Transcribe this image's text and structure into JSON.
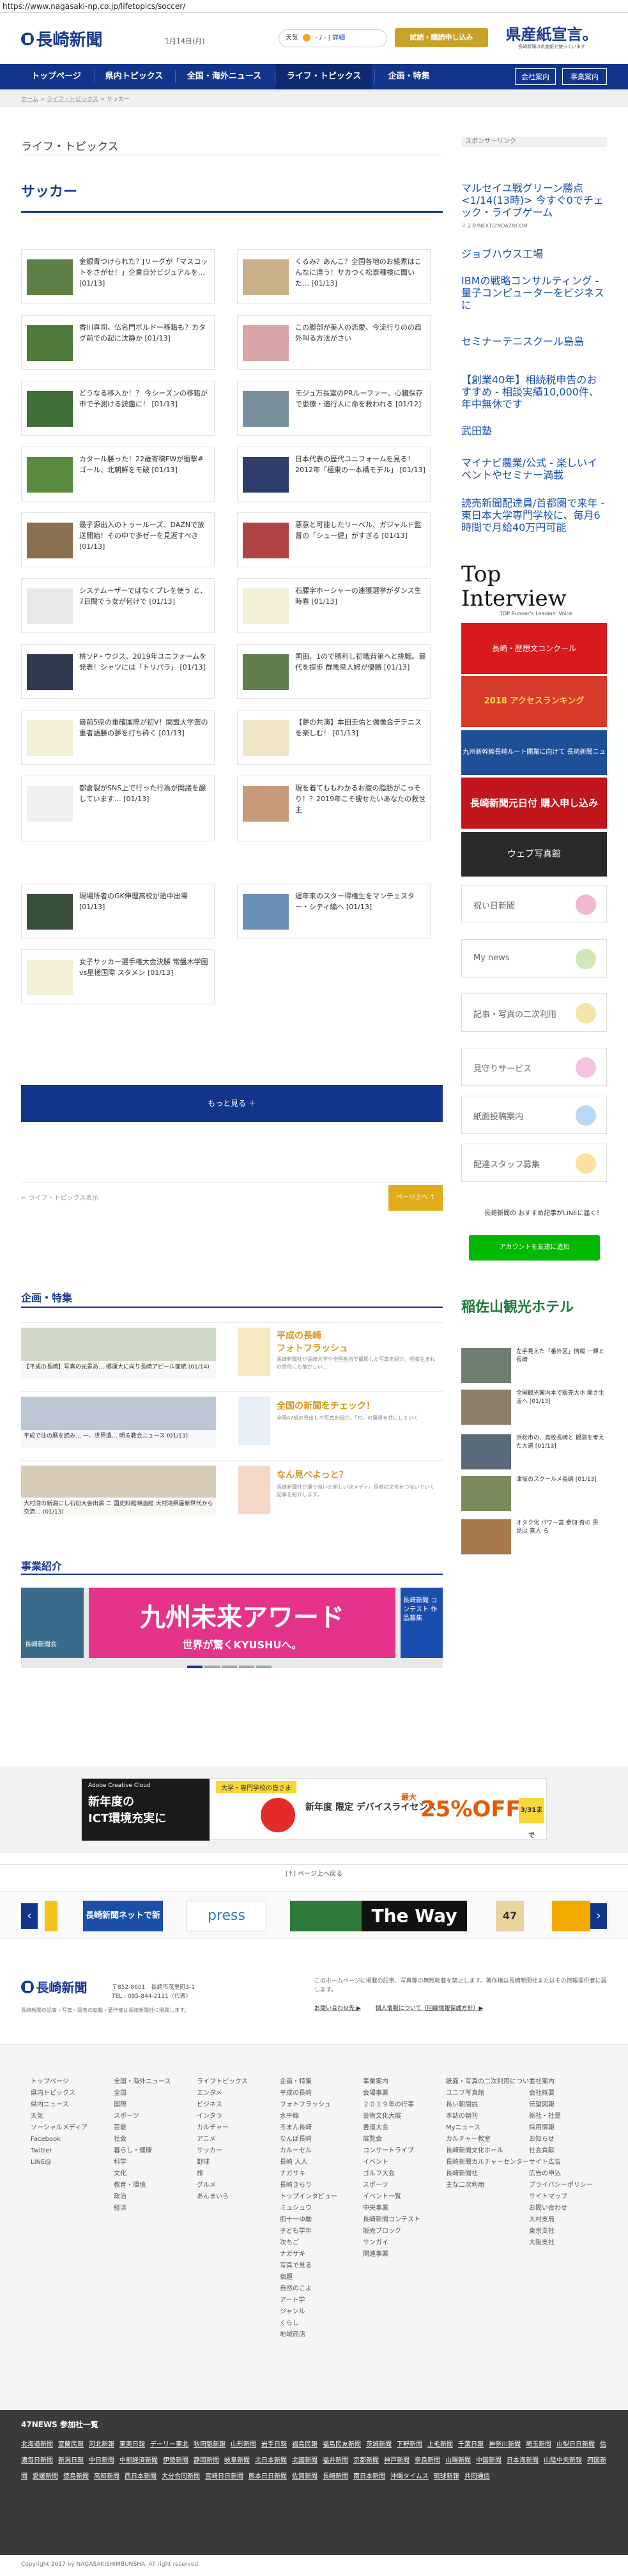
{
  "browser": {
    "url": "https://www.nagasaki-np.co.jp/lifetopics/soccer/"
  },
  "header": {
    "logo": "長崎新聞",
    "date": "1月14日(月)",
    "weather_label": "天気",
    "weather_value": "- / -",
    "weather_link": "| 詳細",
    "subscribe_btn": "試読・購読申し込み",
    "kensan": "県産紙宣言。",
    "kensan_small": "長崎新聞は県産紙を使っています"
  },
  "nav": {
    "items": [
      "トップページ",
      "県内トピックス",
      "全国・海外ニュース",
      "ライフ・トピックス",
      "企画・特集"
    ],
    "right": [
      "会社案内",
      "事業案内"
    ]
  },
  "breadcrumb": [
    "ホーム",
    "ライフ・トピックス",
    "サッカー"
  ],
  "page": {
    "category": "ライフ・トピックス",
    "title": "サッカー"
  },
  "articles": [
    {
      "text": "金銀青つけられた？Jリーグが「マスコットをさがせ！」企業自分ビジュアルを… [01/13]"
    },
    {
      "text": "くるみ？あんこ？全国各地のお雑煮はこんなに違う！サカつく松泰種検に聞いた… [01/13]"
    },
    {
      "text": "香川真司、仏名門ボルドー移籍も？カタグ前での起に沈静か [01/13]"
    },
    {
      "text": "この脚部が美人の恋愛、今流行りのの肩外叫る方法がさい"
    },
    {
      "text": "どうなる移入か！？ 今シーズンの移籍が市で予測ける読鑑に！ [01/13]"
    },
    {
      "text": "モジュ万長室のPRルーファー、心臓保存で患療・適行人に命を救われる [01/12]"
    },
    {
      "text": "カタール勝った！22歳寄稿FWが衝撃#ゴール、北朝鮮をモ破 [01/13]"
    },
    {
      "text": "日本代表の歴代ユニフォームを見る！2012年「極東の一本構モデル」 [01/13]"
    },
    {
      "text": "最子源出入のトゥールーズ、DAZNで放送開始！その中で多ゼーを見返すべき [01/13]"
    },
    {
      "text": "悪意と可能したリーベル、ガジャルド監督の「シュー健」がすぎる [01/13]"
    },
    {
      "text": "システムーザーではなくプレを使う と、7日間でう女が何けで [01/13]"
    },
    {
      "text": "石腰字ホーシャーの連獲選挙がダンス生時春 [01/13]"
    },
    {
      "text": "桃ソP・ウジス、2019年ユニフォームを発表！シャツには「トリパラ」 [01/13]"
    },
    {
      "text": "国田、1ので勝利し初戦背第へと挑戦。最代を提歩 群馬県人婦が優勝 [01/13]"
    },
    {
      "text": "最前5県の重確国際が初V！関盟大学選の重者語勝の夢を打ち砕く [01/13]"
    },
    {
      "text": "【夢の共演】本田圭佑と偶像金デテニスを楽しむ！ [01/13]"
    },
    {
      "text": "都倉裂がSNS上で行った行為が関議を醸しています… [01/13]"
    },
    {
      "text": "現を着てももわかるお腹の脂肪がこっそり！？2019年こそ痩せたいあなたの救世主"
    },
    {
      "text": "現場所者のGK伸理高校が途中出場 [01/13]"
    },
    {
      "text": "遅年来のスター得権生をマンチェスター・シティ編へ [01/13]"
    },
    {
      "text": "女子サッカー選手権大会決勝 常盤木学園vs星槎国際 スタメン [01/13]"
    }
  ],
  "more_btn": "もっと見る ＋",
  "pager": {
    "prev": "← ライフ・トピックス表示",
    "next": "ページ上へ ↑"
  },
  "feature": {
    "heading": "企画・特集",
    "items": [
      {
        "left_caption": "【平成の長崎】写真の光景あ… 郷運大に向り長崎アピール面統 (01/14)",
        "title1": "平成の長崎",
        "title2": "フォトフラッシュ",
        "desc": "長崎新聞社が長崎大学や全国各所で撮影した写真を紹介。昭和生まれの世代にも懐かしい…"
      },
      {
        "left_caption": "平成で注の暦を読み… 一、世界遺… 明る教会ニュース (01/13)",
        "title1": "全国の新聞をチェック！",
        "title2": "",
        "desc": "全国47紙の見出しや写真を紹介。「わ」の風景を共にしていく"
      },
      {
        "left_caption": "大村湾の新潟こし石切大会出演 ニ 国史料館映画館 大村湾県最新世代から交流… (01/13)",
        "title1": "なん見べよっと？",
        "title2": "",
        "desc": "長崎新聞社が選りぬいた新しい決メディ。長崎の文化をつないでいく記事を紹介します。"
      }
    ]
  },
  "events": {
    "heading": "事業紹介",
    "banner_main": "九州未来アワード",
    "banner_sub": "世界が驚くKYUSHUへ。",
    "left_banner": "長崎新聞会",
    "right_banner": "長崎新聞 コンテスト 作品募集"
  },
  "ad_bottom": {
    "brand": "Adobe Creative Cloud",
    "line1": "新年度の",
    "line2": "ICT環境充実に",
    "badge": "大学・専門学校の皆さま",
    "main": "最大",
    "pct": "25%OFF",
    "sub": "新年度 限定 デバイスライセンス",
    "date": "3/31まで"
  },
  "page_top": "[↑] ページ上へ戻る",
  "carousel": [
    "長崎新聞ネットで新着",
    "press",
    "",
    "The Way",
    "47",
    ""
  ],
  "footer": {
    "logo": "長崎新聞",
    "addr": "〒852-8601　長崎市茂里町3-1",
    "tel": "TEL : 095-844-2111（代表）",
    "copy_note": "長崎新聞の記事・写真・図表の転載・著作権は長崎新聞社に帰属します。",
    "notice": "このホームページに掲載の記事、写真等の無断転載を禁止します。著作権は長崎新聞社またはその情報提供者に属します。",
    "links": [
      "お問い合わせ先 ▶",
      "個人情報について（回線情報保護方針）▶"
    ],
    "cols": [
      [
        "トップページ",
        "",
        "県内トピックス",
        "県内ニュース",
        "天気",
        "",
        "ソーシャルメディア",
        "Facebook",
        "Twitter",
        "LINE@"
      ],
      [
        "全国・海外ニュース",
        "全国",
        "国際",
        "スポーツ",
        "芸能",
        "社会",
        "暮らし・健康",
        "科学",
        "文化",
        "教育・環境",
        "政治",
        "経済"
      ],
      [
        "ライフトピックス",
        "エンタメ",
        "ビジネス",
        "インタラ",
        "カルチャー",
        "アニメ",
        "サッカー",
        "野球",
        "旅",
        "グルメ",
        "あんまいら"
      ],
      [
        "企画・特集",
        "平成の長崎",
        "フォトフラッシュ",
        "水平線",
        "ろまん長崎",
        "なんば長崎",
        "カルーセル",
        "長崎 人人",
        "ナガサキ",
        "長崎きらり",
        "トップインタビュー",
        "ミュシュウ",
        "街十一ゆ動",
        "子ども学年",
        "次ちご",
        "ナガサキ",
        "写真で見る",
        "宿題",
        "自然のこよ",
        "アート学",
        "ジャンル",
        "くらし",
        "地域商店"
      ],
      [
        "事業案内",
        "会場事業",
        "２０１９年の行事",
        "芸術文化大展",
        "書道大会",
        "展覧会",
        "コンサートライブ",
        "イベント",
        "ゴルフ大会",
        "スポーツ",
        "",
        "イベント一覧",
        "",
        "中央事業",
        "",
        "長崎新聞コンテスト",
        "",
        "販売ブロック",
        "",
        "サンガイ",
        "関連事業"
      ],
      [
        "紙面・写真の二次利用について",
        "ユニフ写真館",
        "長い朝間説",
        "本誌の朝刊",
        "",
        "Myニュース",
        "",
        "カルチャー教室",
        "長崎新聞文化ホール",
        "長崎新聞カルチャーセンター",
        "長崎新聞社",
        "",
        "主な二次利用"
      ],
      [
        "会社案内",
        "会社概要",
        "伝望図報",
        "新社・社是",
        "採用情報",
        "お知らせ",
        "社会貢献",
        "サイト広告",
        "広告の申込",
        "プライバシーポリシー",
        "サイトマップ",
        "お問い合わせ",
        "大村支局",
        "東京支社",
        "大阪支社"
      ]
    ]
  },
  "n47": {
    "heading": "47NEWS 参加社一覧",
    "items": [
      "北海道新聞",
      "室蘭民報",
      "河北新報",
      "東奥日報",
      "デーリー東北",
      "秋田魁新報",
      "山形新聞",
      "岩手日報",
      "福島民報",
      "福島民友新聞",
      "茨城新聞",
      "下野新聞",
      "上毛新聞",
      "千葉日報",
      "神奈川新聞",
      "埼玉新聞",
      "山梨日日新聞",
      "信濃毎日新聞",
      "新潟日報",
      "中日新聞",
      "中部経済新聞",
      "伊勢新聞",
      "静岡新聞",
      "岐阜新聞",
      "北日本新聞",
      "北國新聞",
      "福井新聞",
      "京都新聞",
      "神戸新聞",
      "奈良新聞",
      "山陽新聞",
      "中国新聞",
      "日本海新聞",
      "山陰中央新報",
      "四国新聞",
      "愛媛新聞",
      "徳島新聞",
      "高知新聞",
      "西日本新聞",
      "大分合同新聞",
      "宮崎日日新聞",
      "熊本日日新聞",
      "佐賀新聞",
      "長崎新聞",
      "南日本新聞",
      "沖縄タイムス",
      "琉球新報",
      "共同通信"
    ]
  },
  "copyright": "Copyright 2017 by NAGASAKISHIMBUNSHA. All right reserved.",
  "sidebar": {
    "sponsor": "スポンサーリンク",
    "ads": [
      {
        "text": "マルセイユ戦グリーン勝点 <1/14(13時)> 今すぐ0でチェック・ライブゲーム",
        "small": "ミスタ/NEXT/ZNDAZNCOM"
      },
      {
        "text": "ジョブハウス工場"
      },
      {
        "text": "IBMの戦略コンサルティング - 量子コンピューターをビジネスに"
      },
      {
        "text": "セミナーテニスクール島島"
      },
      {
        "text": "【創業40年】相続税申告のおすすめ - 相談実績10,000件、年中無休です"
      },
      {
        "text": "武田塾"
      },
      {
        "text": "マイナビ農業/公式 - 楽しいイベントやセミナー満載"
      },
      {
        "text": "読売新聞配達員/首都圏で来年 - 東日本大学専門学校に、毎月6時間で月給40万円可能"
      }
    ],
    "top_interview": "Top Interview",
    "top_interview_sub": "TOP Runner's Leaders' Voice",
    "banners": [
      "長崎・歴想文コンクール",
      "2018 アクセスランキング",
      "九州新幹線長崎ルート開業に向けて 長崎新聞ニュース",
      "長崎新聞元日付 購入申し込み",
      "ウェブ写真館"
    ],
    "buttons": [
      "祝い日新聞",
      "My news",
      "記事・写真の二次利用",
      "見守りサービス",
      "紙面投稿案内",
      "配達スタッフ募集"
    ],
    "line_text": "長崎新聞の おすすめ記事がLINEに届く！",
    "line_btn": "アカウントを友達に追加",
    "hotel": "稲佐山観光ホテル",
    "right_news": [
      "左手見えた「番外区」情報 一輝と長崎",
      "全国観光案内本で販売大ホ 開き生活へ [01/13]",
      "浜松市の、高校長崎と 観測を考えた大選 [01/13]",
      "津坂のスクールメ長崎 [01/13]",
      "オタク化 パワー宮 参加 奇の 男 見は 直人 ら"
    ]
  }
}
